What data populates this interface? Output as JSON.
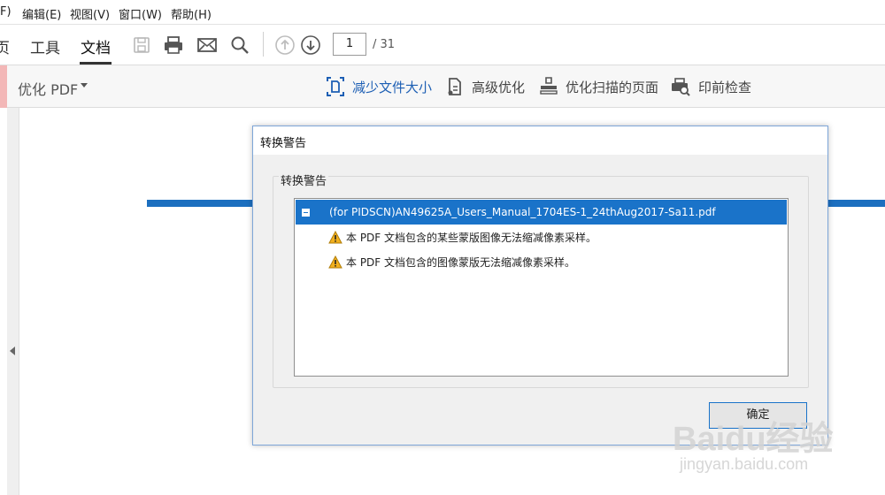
{
  "menubar": {
    "items": [
      "F)",
      "编辑(E)",
      "视图(V)",
      "窗口(W)",
      "帮助(H)"
    ]
  },
  "toolbar": {
    "tabs": [
      "页",
      "工具",
      "文档"
    ],
    "active_tab": "文档",
    "icons": [
      "save-icon",
      "print-icon",
      "email-icon",
      "search-icon",
      "page-up-icon",
      "page-down-icon"
    ],
    "page_current": "1",
    "page_total": "/ 31"
  },
  "optimize_bar": {
    "title": "优化 PDF",
    "tools": [
      "减少文件大小",
      "高级优化",
      "优化扫描的页面",
      "印前检查"
    ]
  },
  "dialog": {
    "title": "转换警告",
    "group_label": "转换警告",
    "file_row": "(for PIDSCN)AN49625A_Users_Manual_1704ES-1_24thAug2017-Sa11.pdf",
    "warnings": [
      "本 PDF 文档包含的某些蒙版图像无法缩减像素采样。",
      "本 PDF 文档包含的图像蒙版无法缩减像素采样。"
    ],
    "ok_label": "确定"
  },
  "watermark": {
    "brand": "Baidu经验",
    "url": "jingyan.baidu.com"
  },
  "colors": {
    "accent_blue": "#1a73c9",
    "selection": "#1a73c9",
    "warning": "#f2b01e"
  }
}
